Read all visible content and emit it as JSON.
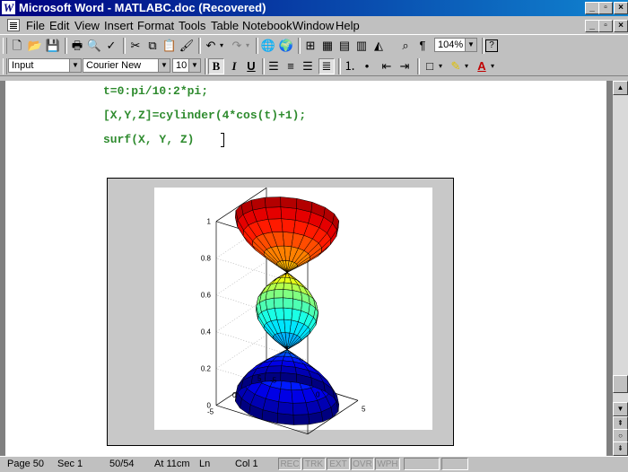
{
  "window": {
    "app_icon": "W",
    "title": "Microsoft Word - MATLABC.doc (Recovered)",
    "controls": [
      "_",
      "▫",
      "×"
    ]
  },
  "menubar": {
    "items": [
      "File",
      "Edit",
      "View",
      "Insert",
      "Format",
      "Tools",
      "Table",
      "Notebook",
      "Window",
      "Help"
    ],
    "doc_controls": [
      "_",
      "▫",
      "×"
    ]
  },
  "toolbar": {
    "zoom": "104%",
    "help": "?"
  },
  "format_toolbar": {
    "style": "Input",
    "font": "Courier New",
    "size": "10",
    "bold": "B",
    "italic": "I",
    "underline": "U",
    "font_color_letter": "A"
  },
  "document": {
    "code_lines": [
      "t=0:pi/10:2*pi;",
      "[X,Y,Z]=cylinder(4*cos(t)+1);",
      "surf(X, Y, Z)"
    ],
    "code_color": "#2e8b2e"
  },
  "figure": {
    "z_ticks": [
      "1",
      "0.8",
      "0.6",
      "0.4",
      "0.2",
      "0"
    ],
    "y_ticks": [
      "5",
      "0",
      "-5"
    ],
    "x_ticks": [
      "-5",
      "0",
      "5"
    ],
    "colormap": "jet"
  },
  "statusbar": {
    "page": "Page 50",
    "section": "Sec 1",
    "pages": "50/54",
    "at": "At 11cm",
    "ln": "Ln",
    "col": "Col 1",
    "indicators": [
      "REC",
      "TRK",
      "EXT",
      "OVR",
      "WPH"
    ]
  }
}
